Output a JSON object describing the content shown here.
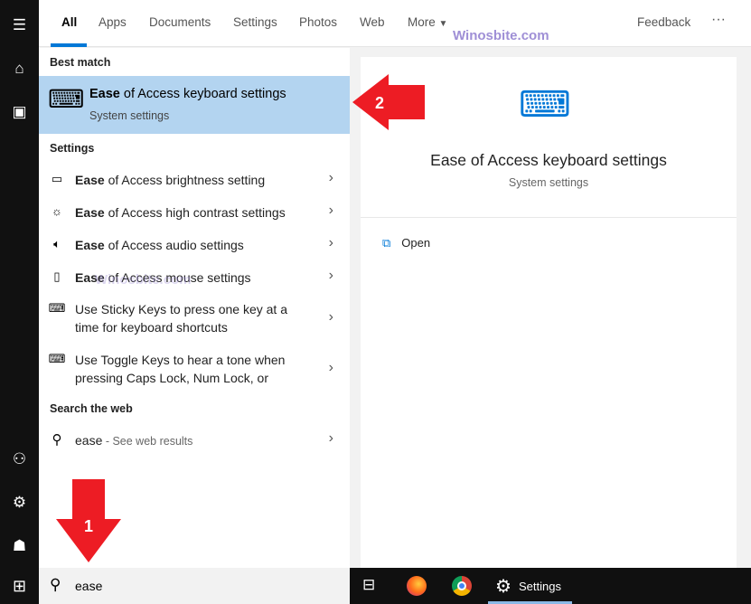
{
  "sidebar": {
    "icons": [
      "hamburger-icon",
      "home-icon",
      "notebook-icon",
      "add-user-icon",
      "gear-icon",
      "feedback-person-icon",
      "windows-start-icon"
    ]
  },
  "tabs": [
    {
      "label": "All",
      "active": true
    },
    {
      "label": "Apps"
    },
    {
      "label": "Documents"
    },
    {
      "label": "Settings"
    },
    {
      "label": "Photos"
    },
    {
      "label": "Web"
    },
    {
      "label": "More"
    }
  ],
  "header": {
    "feedback": "Feedback",
    "more_options": "···"
  },
  "watermark": "Winosbite.com",
  "results": {
    "best_match_header": "Best match",
    "best_match": {
      "title_bold": "Ease",
      "title_rest": " of Access keyboard settings",
      "subtitle": "System settings"
    },
    "settings_header": "Settings",
    "settings": [
      {
        "icon": "monitor-icon",
        "bold": "Ease",
        "rest": " of Access brightness setting"
      },
      {
        "icon": "brightness-icon",
        "bold": "Ease",
        "rest": " of Access high contrast settings"
      },
      {
        "icon": "speaker-icon",
        "bold": "Ease",
        "rest": " of Access audio settings"
      },
      {
        "icon": "mouse-icon",
        "bold": "Ease",
        "rest": " of Access mouse settings"
      },
      {
        "icon": "keyboard-icon",
        "bold": "",
        "rest": "Use Sticky Keys to press one key at a time for keyboard shortcuts"
      },
      {
        "icon": "keyboard-icon",
        "bold": "",
        "rest": "Use Toggle Keys to hear a tone when pressing Caps Lock, Num Lock, or"
      }
    ],
    "web_header": "Search the web",
    "web": {
      "query": "ease",
      "suffix": " - See web results"
    }
  },
  "detail": {
    "title": "Ease of Access keyboard settings",
    "subtitle": "System settings",
    "open_label": "Open"
  },
  "search": {
    "value": "ease"
  },
  "taskbar": {
    "settings_label": "Settings"
  },
  "annotations": {
    "arrow1": "1",
    "arrow2": "2",
    "color": "#ed1c24"
  },
  "colors": {
    "accent": "#0078d7",
    "selection": "#b3d4f0"
  }
}
